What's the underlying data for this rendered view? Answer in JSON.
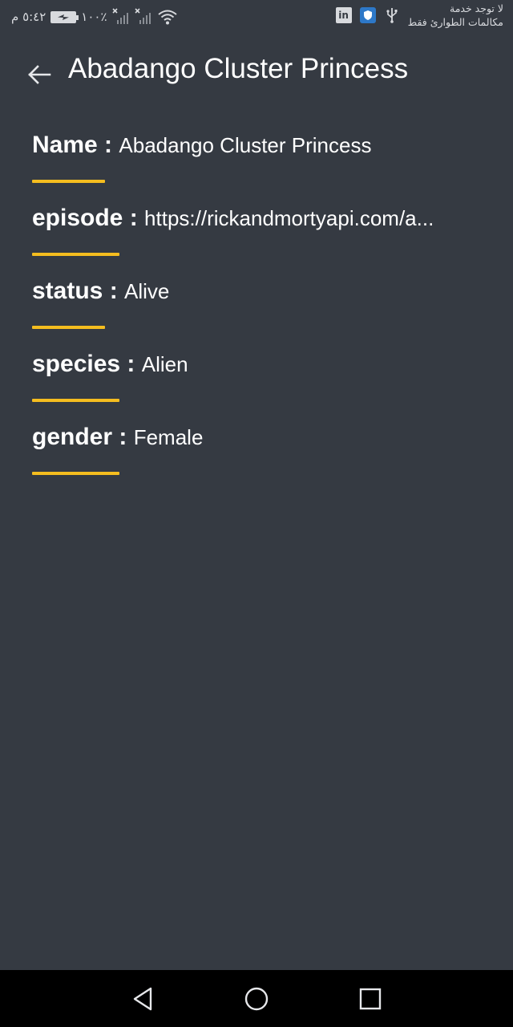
{
  "status_bar": {
    "time": "٥:٤٢ م",
    "battery_percent": "١٠٠٪",
    "carrier_line1": "لا توجد خدمة",
    "carrier_line2": "مكالمات الطوارئ فقط",
    "icons": [
      "battery-charging-icon",
      "signal-no-service-icon",
      "signal-no-service-icon",
      "wifi-icon",
      "usb-icon",
      "shield-icon",
      "linkedin-icon"
    ],
    "linkedin_label": "in"
  },
  "app_bar": {
    "title": "Abadango Cluster Princess",
    "back_icon": "arrow-back-icon"
  },
  "details": [
    {
      "key": "Name",
      "separator": " : ",
      "value": "Abadango Cluster Princess"
    },
    {
      "key": "episode",
      "separator": " : ",
      "value": "https://rickandmortyapi.com/a..."
    },
    {
      "key": "status",
      "separator": " : ",
      "value": "Alive"
    },
    {
      "key": "species",
      "separator": " : ",
      "value": "Alien"
    },
    {
      "key": "gender",
      "separator": " : ",
      "value": "Female"
    }
  ],
  "colors": {
    "background": "#353a42",
    "accent": "#f5bd1f",
    "nav_background": "#000000"
  },
  "nav_bar": {
    "buttons": [
      "back-triangle-icon",
      "home-circle-icon",
      "recents-square-icon"
    ]
  }
}
